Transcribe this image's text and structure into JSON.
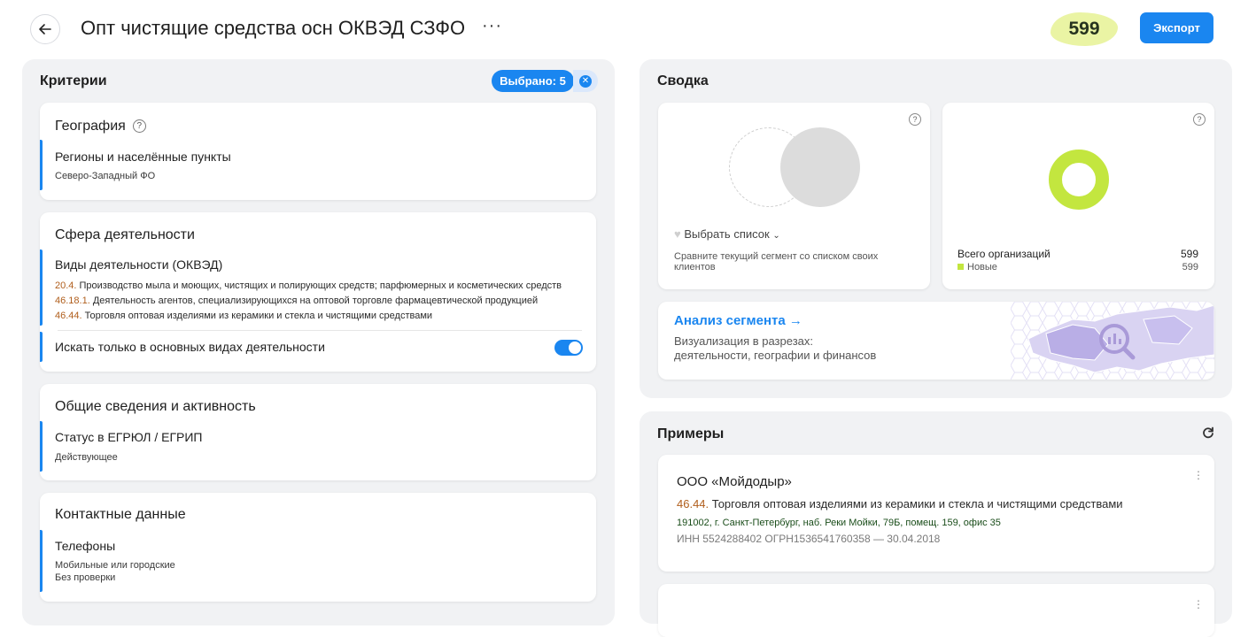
{
  "header": {
    "title": "Опт чистящие средства осн ОКВЭД СЗФО",
    "more": "···",
    "count": "599",
    "export_label": "Экспорт"
  },
  "criteria": {
    "title": "Критерии",
    "selected_label": "Выбрано: 5",
    "geography": {
      "title": "География",
      "help": "?",
      "field_label": "Регионы и населённые пункты",
      "field_value": "Северо-Западный ФО"
    },
    "sphere": {
      "title": "Сфера деятельности",
      "field_label": "Виды деятельности (ОКВЭД)",
      "items": [
        {
          "code": "20.4.",
          "text": " Производство мыла и моющих, чистящих и полирующих средств; парфюмерных и косметических средств"
        },
        {
          "code": "46.18.1.",
          "text": " Деятельность агентов, специализирующихся на оптовой торговле фармацевтической продукцией"
        },
        {
          "code": "46.44.",
          "text": " Торговля оптовая изделиями из керамики и стекла и чистящими средствами"
        }
      ],
      "toggle_label": "Искать только в основных видах деятельности",
      "toggle_on": true
    },
    "general": {
      "title": "Общие сведения и активность",
      "field_label": "Статус в ЕГРЮЛ / ЕГРИП",
      "field_value": "Действующее"
    },
    "contacts": {
      "title": "Контактные данные",
      "field_label": "Телефоны",
      "field_value_1": "Мобильные или городские",
      "field_value_2": "Без проверки"
    }
  },
  "summary": {
    "title": "Сводка",
    "compare": {
      "help": "?",
      "pick_label": "Выбрать список",
      "desc": "Сравните текущий сегмент со списком своих клиентов"
    },
    "totals": {
      "help": "?",
      "total_label": "Всего организаций",
      "total_value": "599",
      "new_label": "Новые",
      "new_value": "599",
      "ring_color": "#c3e63f"
    },
    "analysis": {
      "link": "Анализ сегмента →",
      "desc_1": "Визуализация в разрезах:",
      "desc_2": "деятельности, географии и финансов"
    }
  },
  "examples": {
    "title": "Примеры",
    "refresh_icon": "refresh-icon",
    "items": [
      {
        "name": "ООО «Мойдодыр»",
        "code": "46.44.",
        "activity": " Торговля оптовая изделиями из керамики и стекла и чистящими средствами",
        "address": "191002, г. Санкт-Петербург, наб. Реки Мойки, 79Б, помещ. 159, офис 35",
        "ids": "ИНН 5524288402    ОГРН1536541760358 — 30.04.2018"
      }
    ]
  },
  "colors": {
    "accent": "#1a86f0",
    "count_highlight": "#eaf4a4",
    "okved_code": "#b05e1c"
  }
}
